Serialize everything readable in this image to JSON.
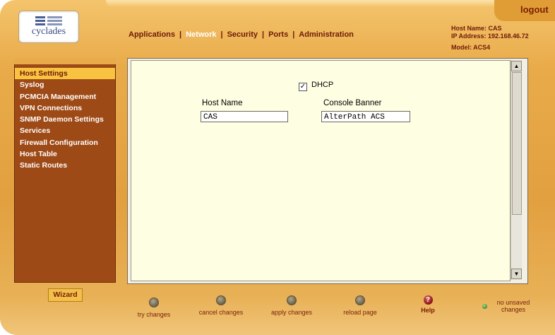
{
  "brand": {
    "logo_text": "cyclades"
  },
  "header": {
    "logout": "logout",
    "nav": [
      {
        "label": "Applications",
        "active": false
      },
      {
        "label": "Network",
        "active": true
      },
      {
        "label": "Security",
        "active": false
      },
      {
        "label": "Ports",
        "active": false
      },
      {
        "label": "Administration",
        "active": false
      }
    ],
    "nav_separator": "|",
    "host_info": {
      "host_name": "Host Name: CAS",
      "ip_address": "IP Address: 192.168.46.72",
      "model": "Model: ACS4"
    }
  },
  "sidebar": {
    "items": [
      {
        "label": "Host Settings",
        "active": true
      },
      {
        "label": "Syslog",
        "active": false
      },
      {
        "label": "PCMCIA Management",
        "active": false
      },
      {
        "label": "VPN Connections",
        "active": false
      },
      {
        "label": "SNMP Daemon Settings",
        "active": false
      },
      {
        "label": "Services",
        "active": false
      },
      {
        "label": "Firewall Configuration",
        "active": false
      },
      {
        "label": "Host Table",
        "active": false
      },
      {
        "label": "Static Routes",
        "active": false
      }
    ],
    "wizard": "Wizard"
  },
  "form": {
    "dhcp": {
      "label": "DHCP",
      "checked": true
    },
    "host_name": {
      "label": "Host Name",
      "value": "CAS"
    },
    "console_banner": {
      "label": "Console Banner",
      "value": "AlterPath ACS"
    }
  },
  "actions": [
    {
      "label": "try changes"
    },
    {
      "label": "cancel changes"
    },
    {
      "label": "apply changes"
    },
    {
      "label": "reload page"
    }
  ],
  "help": {
    "label": "Help"
  },
  "status": {
    "line1": "no unsaved",
    "line2": "changes"
  },
  "colors": {
    "frame": "#e2a040",
    "sidebar": "#9e4a16",
    "sidebar_active": "#f7c341",
    "panel": "#fefee3",
    "text_dark": "#6d1a08"
  }
}
